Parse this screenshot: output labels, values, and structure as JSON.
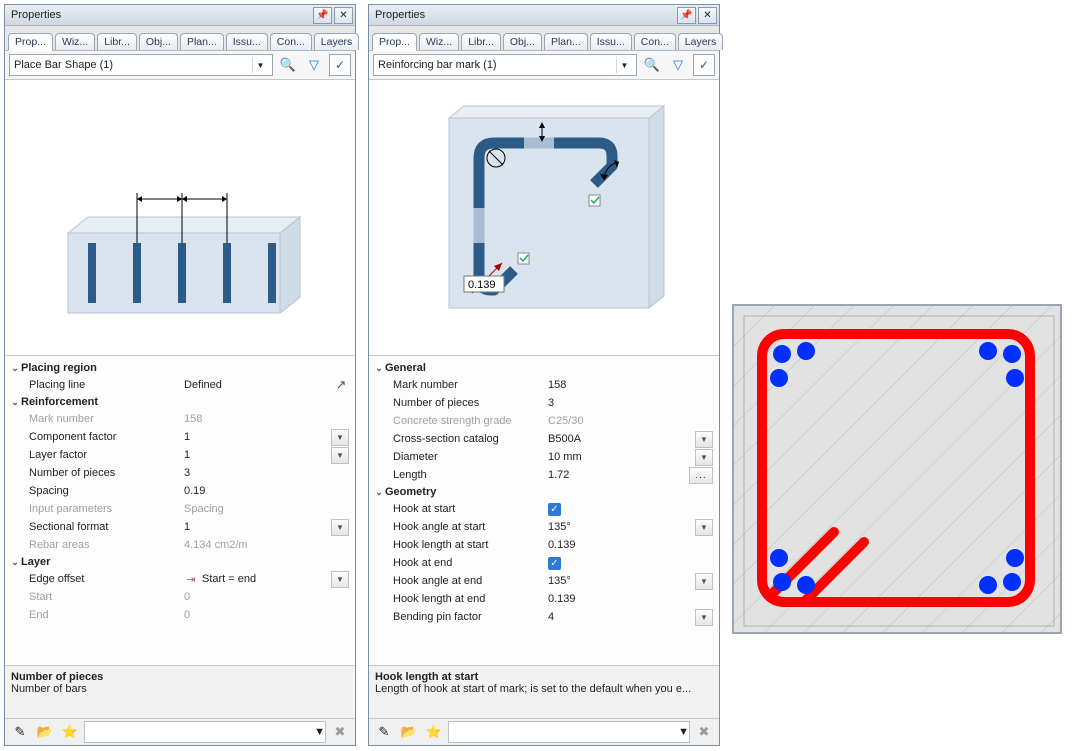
{
  "panel1": {
    "title": "Properties",
    "tabs": [
      "Prop...",
      "Wiz...",
      "Libr...",
      "Obj...",
      "Plan...",
      "Issu...",
      "Con...",
      "Layers"
    ],
    "selection": "Place Bar Shape (1)",
    "groups": {
      "placing_region": "Placing region",
      "reinforcement": "Reinforcement",
      "layer": "Layer"
    },
    "rows": {
      "placing_line_label": "Placing line",
      "placing_line_value": "Defined",
      "mark_number_label": "Mark number",
      "mark_number_value": "158",
      "component_factor_label": "Component factor",
      "component_factor_value": "1",
      "layer_factor_label": "Layer factor",
      "layer_factor_value": "1",
      "number_pieces_label": "Number of pieces",
      "number_pieces_value": "3",
      "spacing_label": "Spacing",
      "spacing_value": "0.19",
      "input_params_label": "Input parameters",
      "input_params_value": "Spacing",
      "sectional_format_label": "Sectional format",
      "sectional_format_value": "1",
      "rebar_areas_label": "Rebar areas",
      "rebar_areas_value": "4.134 cm2/m",
      "edge_offset_label": "Edge offset",
      "edge_offset_value": "Start = end",
      "start_label": "Start",
      "start_value": "0",
      "end_label": "End",
      "end_value": "0"
    },
    "desc_title": "Number of pieces",
    "desc_text": "Number of bars"
  },
  "panel2": {
    "title": "Properties",
    "tabs": [
      "Prop...",
      "Wiz...",
      "Libr...",
      "Obj...",
      "Plan...",
      "Issu...",
      "Con...",
      "Layers"
    ],
    "selection": "Reinforcing bar mark (1)",
    "preview_value": "0.139",
    "groups": {
      "general": "General",
      "geometry": "Geometry"
    },
    "rows": {
      "mark_number_label": "Mark number",
      "mark_number_value": "158",
      "number_pieces_label": "Number of pieces",
      "number_pieces_value": "3",
      "concrete_grade_label": "Concrete strength grade",
      "concrete_grade_value": "C25/30",
      "cross_section_label": "Cross-section catalog",
      "cross_section_value": "B500A",
      "diameter_label": "Diameter",
      "diameter_value": "10 mm",
      "length_label": "Length",
      "length_value": "1.72",
      "hook_start_label": "Hook at start",
      "hook_angle_start_label": "Hook angle at start",
      "hook_angle_start_value": "135°",
      "hook_length_start_label": "Hook length at start",
      "hook_length_start_value": "0.139",
      "hook_end_label": "Hook at end",
      "hook_angle_end_label": "Hook angle at end",
      "hook_angle_end_value": "135°",
      "hook_length_end_label": "Hook length at end",
      "hook_length_end_value": "0.139",
      "bending_pin_label": "Bending pin factor",
      "bending_pin_value": "4"
    },
    "desc_title": "Hook length at start",
    "desc_text": "Length of hook at start of mark; is set to the default when you e..."
  }
}
